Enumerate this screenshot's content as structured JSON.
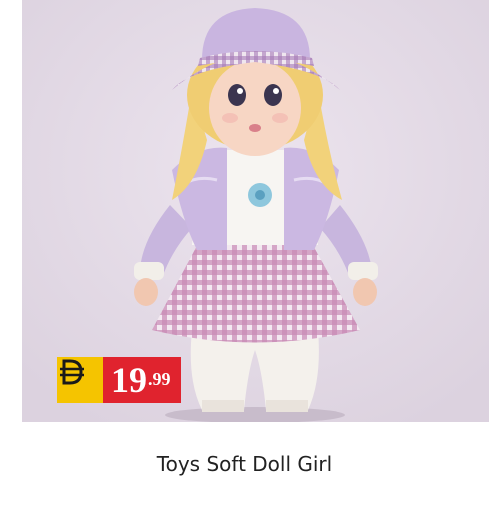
{
  "product": {
    "title": "Toys Soft Doll Girl",
    "price_main": "19",
    "price_cents": ".99",
    "currency_icon": "dirham-icon"
  },
  "colors": {
    "badge_yellow": "#f5c400",
    "badge_red": "#e0232e",
    "photo_bg": "#e4dbe6"
  }
}
